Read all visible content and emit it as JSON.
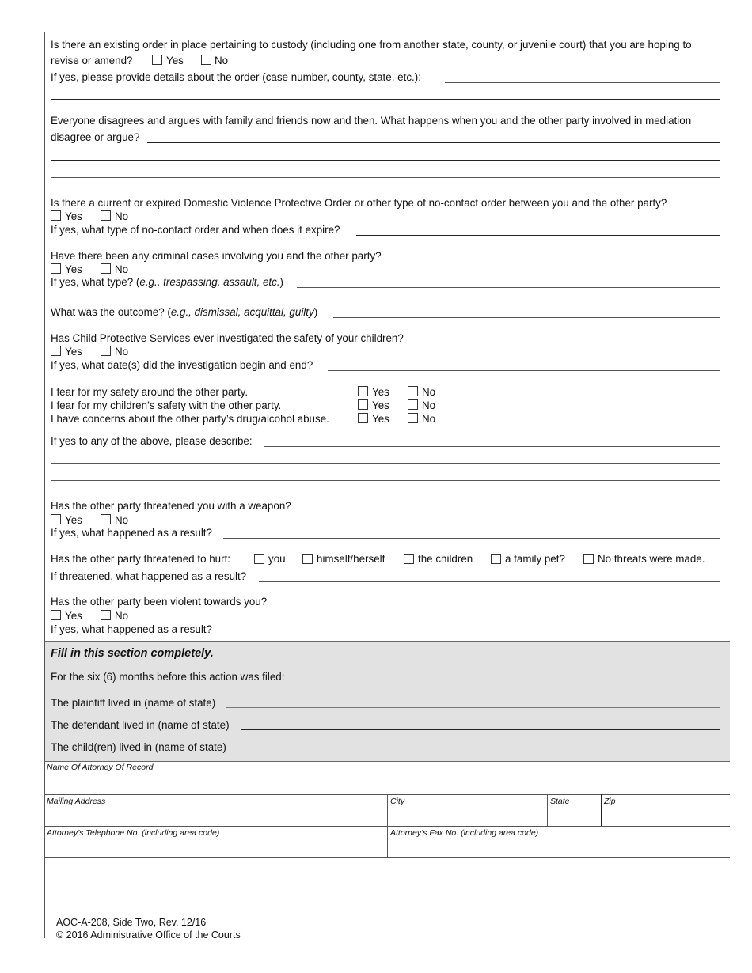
{
  "q_existing_order": {
    "question_line1": "Is there an existing order in place pertaining to custody (including one from another state, county, or juvenile court) that you are hoping to",
    "question_line2": "revise or amend?",
    "yes": "Yes",
    "no": "No",
    "details_label": "If yes, please provide details about the order (case number, county, state, etc.):"
  },
  "q_disagree": {
    "line1": "Everyone disagrees and argues with family and friends now and then. What happens when you and the other party involved in mediation",
    "line2": "disagree or argue?"
  },
  "q_protective_order": {
    "question": "Is there a current or expired Domestic Violence Protective Order or other type of no-contact order between you and the other party?",
    "yes": "Yes",
    "no": "No",
    "followup": "If yes, what type of no-contact order and when does it expire?"
  },
  "q_criminal": {
    "question": "Have there been any criminal cases involving you and the other party?",
    "yes": "Yes",
    "no": "No",
    "type_prefix": "If yes, what type? (",
    "type_examples": "e.g., trespassing, assault, etc.",
    "type_suffix": ")",
    "outcome_prefix": "What was the outcome? (",
    "outcome_examples": "e.g., dismissal, acquittal, guilty",
    "outcome_suffix": ")"
  },
  "q_cps": {
    "question": "Has Child Protective Services ever investigated the safety of your children?",
    "yes": "Yes",
    "no": "No",
    "followup": "If yes, what date(s) did the investigation begin and end?"
  },
  "q_fears": {
    "items": [
      {
        "statement": "I fear for my safety around the other party.",
        "yes": "Yes",
        "no": "No"
      },
      {
        "statement": "I fear for my children’s safety with the other party.",
        "yes": "Yes",
        "no": "No"
      },
      {
        "statement": "I have concerns about the other party’s drug/alcohol abuse.",
        "yes": "Yes",
        "no": "No"
      }
    ],
    "describe_label": "If yes to any of the above, please describe:"
  },
  "q_weapon": {
    "question": "Has the other party threatened you with a weapon?",
    "yes": "Yes",
    "no": "No",
    "followup": "If yes, what happened as a result?"
  },
  "q_threatened": {
    "question": "Has the other party threatened to hurt:",
    "options": [
      "you",
      "himself/herself",
      "the children",
      "a family pet?",
      "No threats were made."
    ],
    "followup": "If threatened, what happened as a result?"
  },
  "q_violent": {
    "question": "Has the other party been violent towards you?",
    "yes": "Yes",
    "no": "No",
    "followup": "If yes, what happened as a result?"
  },
  "residence_section": {
    "heading": "Fill in this section completely.",
    "intro": "For the six (6) months before this action was filed:",
    "plaintiff_label": "The plaintiff lived in (name of state)",
    "defendant_label": "The defendant lived in (name of state)",
    "children_label": "The child(ren) lived in (name of state)"
  },
  "attorney": {
    "name_label": "Name Of Attorney Of Record",
    "mailing_label": "Mailing Address",
    "city_label": "City",
    "state_label": "State",
    "zip_label": "Zip",
    "phone_label": "Attorney’s Telephone No. (including area code)",
    "fax_label": "Attorney’s Fax No. (including area code)"
  },
  "footer": {
    "form_id": "AOC-A-208, Side Two, Rev. 12/16",
    "copyright": "© 2016 Administrative Office of the Courts"
  }
}
